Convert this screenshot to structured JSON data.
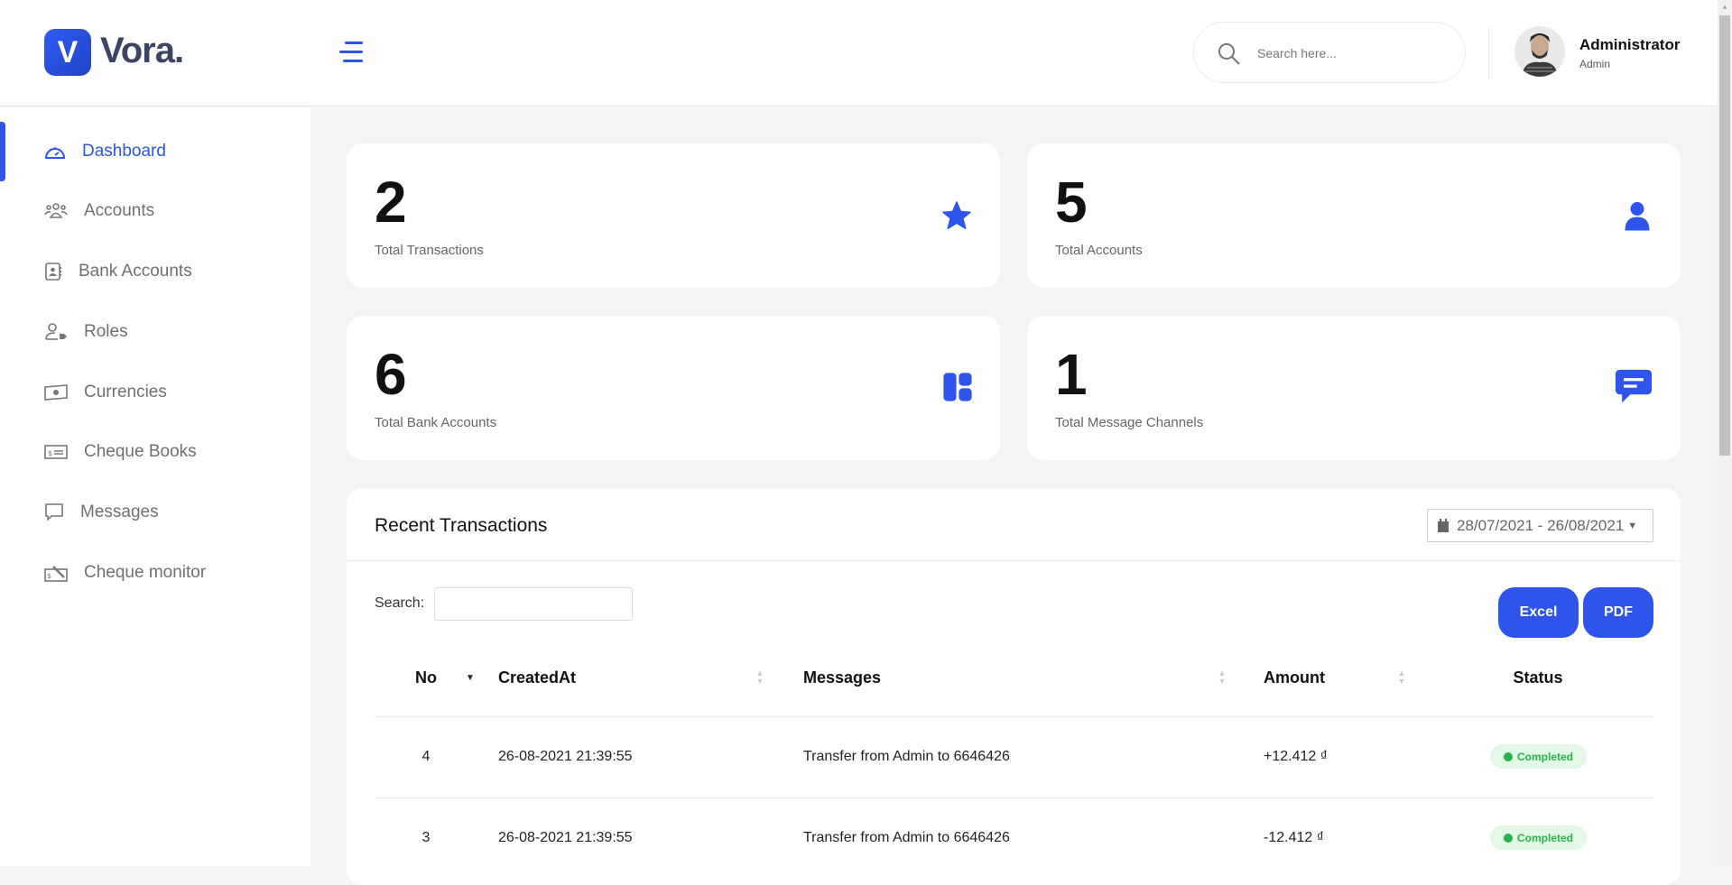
{
  "brand": {
    "logo_letter": "V",
    "name": "Vora."
  },
  "header": {
    "search_placeholder": "Search here...",
    "user_name": "Administrator",
    "user_role": "Admin"
  },
  "sidebar": {
    "items": [
      {
        "label": "Dashboard",
        "icon": "dashboard-gauge-icon",
        "active": true
      },
      {
        "label": "Accounts",
        "icon": "users-icon"
      },
      {
        "label": "Bank Accounts",
        "icon": "contact-book-icon"
      },
      {
        "label": "Roles",
        "icon": "user-tag-icon"
      },
      {
        "label": "Currencies",
        "icon": "banknote-icon"
      },
      {
        "label": "Cheque Books",
        "icon": "cheque-icon"
      },
      {
        "label": "Messages",
        "icon": "message-icon"
      },
      {
        "label": "Cheque monitor",
        "icon": "cheque-sign-icon"
      }
    ]
  },
  "stats": [
    {
      "value": "2",
      "label": "Total Transactions",
      "icon": "star-icon"
    },
    {
      "value": "5",
      "label": "Total Accounts",
      "icon": "user-icon"
    },
    {
      "value": "6",
      "label": "Total Bank Accounts",
      "icon": "dashboard-tiles-icon"
    },
    {
      "value": "1",
      "label": "Total Message Channels",
      "icon": "chat-icon"
    }
  ],
  "transactions": {
    "title": "Recent Transactions",
    "date_range": "28/07/2021 - 26/08/2021",
    "search_label": "Search:",
    "search_value": "",
    "excel_label": "Excel",
    "pdf_label": "PDF",
    "columns": [
      "No",
      "CreatedAt",
      "Messages",
      "Amount",
      "Status"
    ],
    "rows": [
      {
        "no": "4",
        "created_at": "26-08-2021 21:39:55",
        "message": "Transfer from Admin to 6646426",
        "amount": "+12.412 ₫",
        "status": "Completed"
      },
      {
        "no": "3",
        "created_at": "26-08-2021 21:39:55",
        "message": "Transfer from Admin to 6646426",
        "amount": "-12.412 ₫",
        "status": "Completed"
      }
    ]
  },
  "colors": {
    "accent": "#2f54eb",
    "success": "#27b44a",
    "success_bg": "#e3f8e6"
  }
}
